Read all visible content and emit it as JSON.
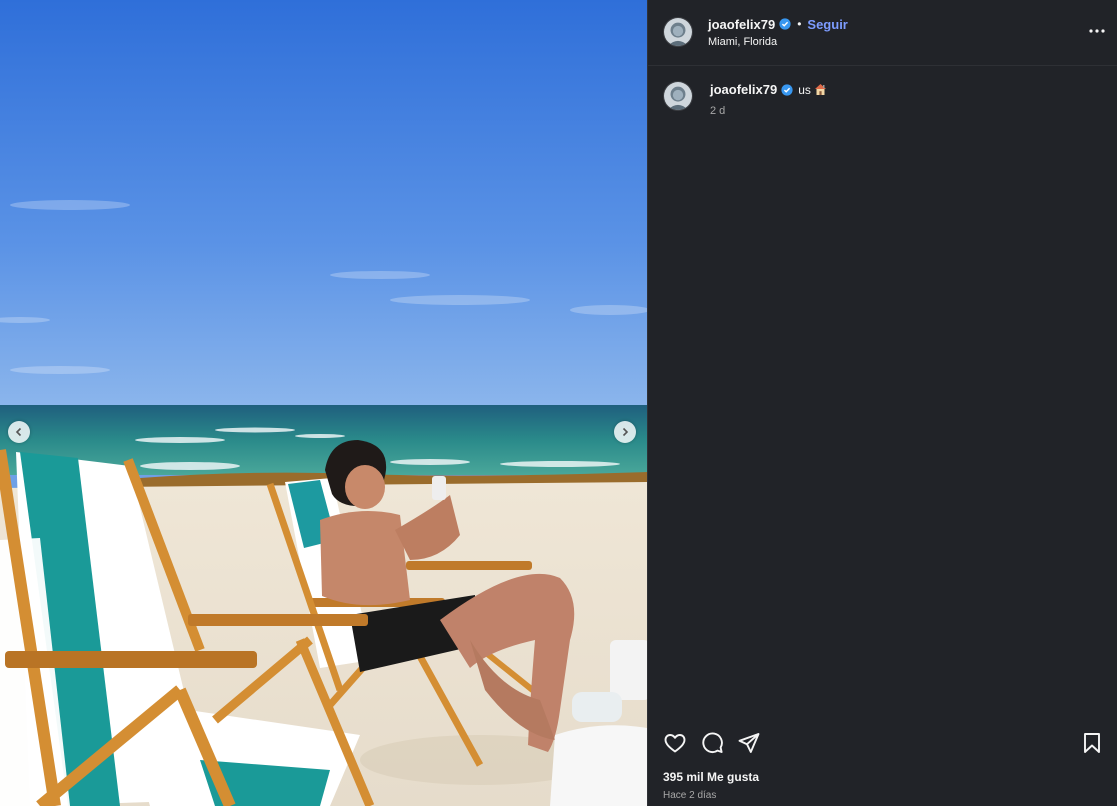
{
  "post": {
    "author": {
      "username": "joaofelix79",
      "verified": true,
      "follow_label": "Seguir",
      "separator": "•",
      "location": "Miami, Florida"
    },
    "caption": {
      "username": "joaofelix79",
      "text": "us",
      "emoji": "house-emoji",
      "time": "2 d"
    },
    "stats": {
      "likes": "395 mil Me gusta",
      "posted": "Hace 2 días"
    },
    "icons": {
      "more": "more-options-icon",
      "like": "heart-icon",
      "comment": "comment-icon",
      "share": "send-icon",
      "save": "bookmark-icon",
      "prev": "chevron-left-icon",
      "next": "chevron-right-icon"
    },
    "colors": {
      "panel_bg": "#212328",
      "accent_link": "#7d9cff",
      "verified_badge": "#3897f0",
      "secondary_text": "#a8a8a8"
    }
  }
}
